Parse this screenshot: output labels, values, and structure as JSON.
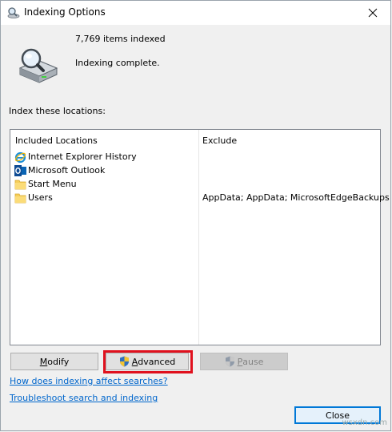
{
  "window": {
    "title": "Indexing Options"
  },
  "status": {
    "items_indexed": "7,769 items indexed",
    "state": "Indexing complete."
  },
  "locations_label": "Index these locations:",
  "list": {
    "headers": {
      "included": "Included Locations",
      "exclude": "Exclude"
    },
    "rows": [
      {
        "label": "Internet Explorer History",
        "icon": "internet-explorer-icon",
        "exclude": ""
      },
      {
        "label": "Microsoft Outlook",
        "icon": "outlook-icon",
        "exclude": ""
      },
      {
        "label": "Start Menu",
        "icon": "folder-icon",
        "exclude": ""
      },
      {
        "label": "Users",
        "icon": "folder-icon",
        "exclude": "AppData; AppData; MicrosoftEdgeBackups"
      }
    ]
  },
  "buttons": {
    "modify": {
      "accel": "M",
      "rest": "odify"
    },
    "advanced": {
      "accel": "A",
      "rest": "dvanced"
    },
    "pause": {
      "accel": "P",
      "rest": "ause"
    },
    "close": "Close"
  },
  "links": {
    "how": "How does indexing affect searches?",
    "troubleshoot": "Troubleshoot search and indexing"
  },
  "watermark": "wsxdn.com",
  "colors": {
    "highlight": "#e0111e",
    "link": "#0066cc",
    "focus_border": "#0078d7"
  }
}
